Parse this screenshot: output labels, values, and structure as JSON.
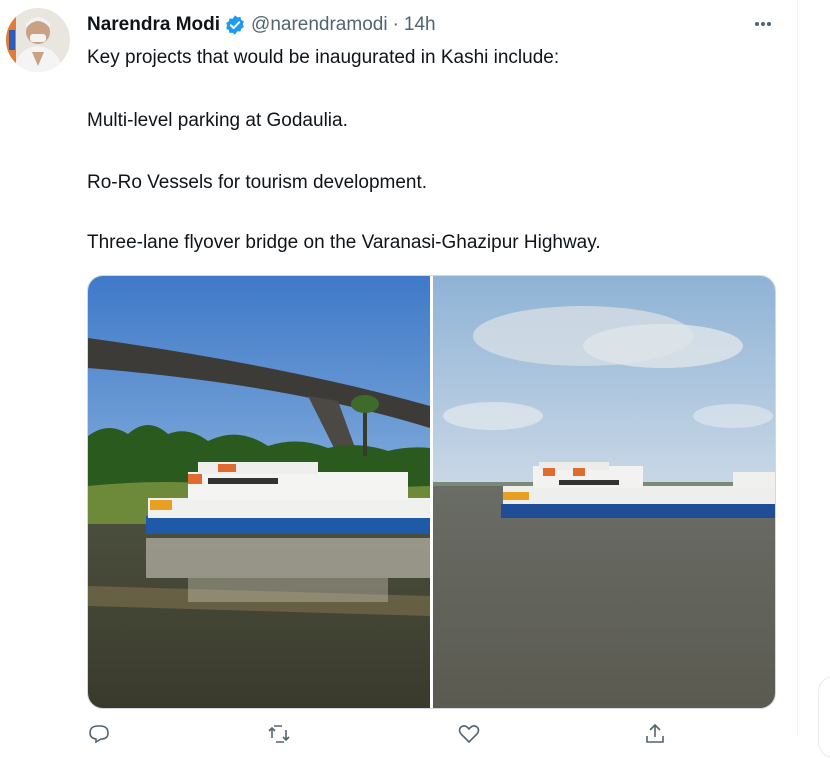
{
  "tweet": {
    "author_name": "Narendra Modi",
    "handle": "@narendramodi",
    "separator": "·",
    "time": "14h",
    "verified": true,
    "more_icon": "more-horizontal-icon",
    "lines": [
      "Key projects that would be inaugurated in Kashi include:",
      "Multi-level parking at Godaulia.",
      "Ro-Ro Vessels for tourism development.",
      "Three-lane flyover bridge on the Varanasi-Ghazipur Highway."
    ],
    "media": [
      {
        "description": "ferry-under-bridge-photo"
      },
      {
        "description": "ferry-on-river-photo"
      }
    ],
    "actions": [
      {
        "icon": "reply-icon"
      },
      {
        "icon": "retweet-icon"
      },
      {
        "icon": "like-icon"
      },
      {
        "icon": "share-icon"
      }
    ]
  },
  "colors": {
    "text": "#0f1419",
    "secondary": "#536471",
    "verified": "#1d9bf0",
    "border": "#cfd9de"
  }
}
